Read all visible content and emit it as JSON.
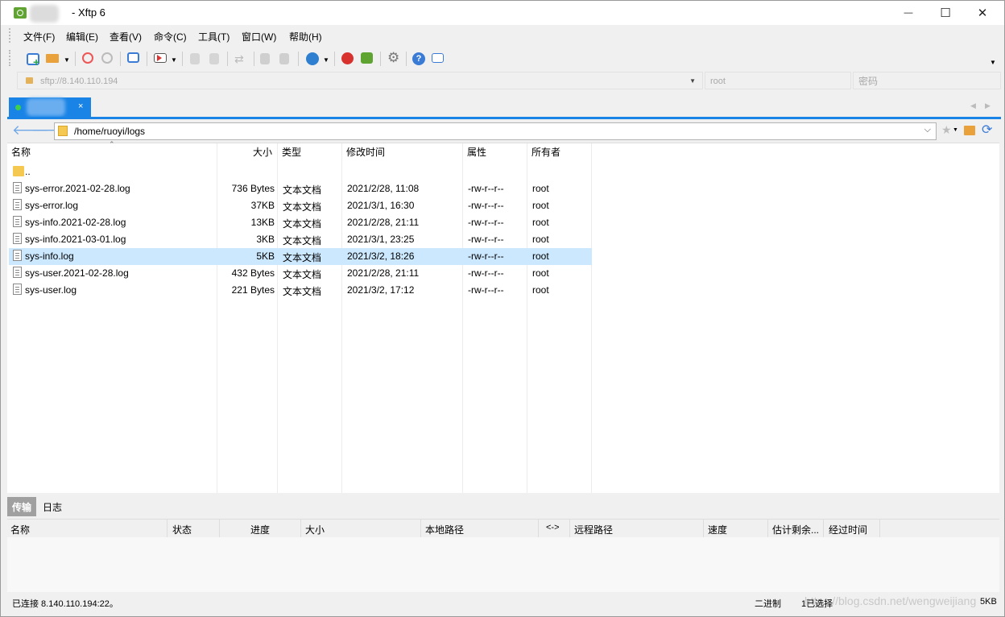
{
  "window": {
    "title": "- Xftp 6",
    "minimize_glyph": "—",
    "maximize_glyph": "☐",
    "close_glyph": "✕"
  },
  "menu": {
    "items": [
      "文件(F)",
      "编辑(E)",
      "查看(V)",
      "命令(C)",
      "工具(T)",
      "窗口(W)",
      "帮助(H)"
    ]
  },
  "address": {
    "host": "sftp://8.140.110.194",
    "username": "root",
    "password_placeholder": "密码"
  },
  "session_tab": {
    "close_glyph": "×"
  },
  "path": {
    "current": "/home/ruoyi/logs"
  },
  "file_list": {
    "columns": [
      "名称",
      "大小",
      "类型",
      "修改时间",
      "属性",
      "所有者"
    ],
    "parent_dir": "..",
    "rows": [
      {
        "name": "sys-error.2021-02-28.log",
        "size": "736 Bytes",
        "type": "文本文档",
        "modified": "2021/2/28, 11:08",
        "attr": "-rw-r--r--",
        "owner": "root"
      },
      {
        "name": "sys-error.log",
        "size": "37KB",
        "type": "文本文档",
        "modified": "2021/3/1, 16:30",
        "attr": "-rw-r--r--",
        "owner": "root"
      },
      {
        "name": "sys-info.2021-02-28.log",
        "size": "13KB",
        "type": "文本文档",
        "modified": "2021/2/28, 21:11",
        "attr": "-rw-r--r--",
        "owner": "root"
      },
      {
        "name": "sys-info.2021-03-01.log",
        "size": "3KB",
        "type": "文本文档",
        "modified": "2021/3/1, 23:25",
        "attr": "-rw-r--r--",
        "owner": "root"
      },
      {
        "name": "sys-info.log",
        "size": "5KB",
        "type": "文本文档",
        "modified": "2021/3/2, 18:26",
        "attr": "-rw-r--r--",
        "owner": "root",
        "selected": true
      },
      {
        "name": "sys-user.2021-02-28.log",
        "size": "432 Bytes",
        "type": "文本文档",
        "modified": "2021/2/28, 21:11",
        "attr": "-rw-r--r--",
        "owner": "root"
      },
      {
        "name": "sys-user.log",
        "size": "221 Bytes",
        "type": "文本文档",
        "modified": "2021/3/2, 17:12",
        "attr": "-rw-r--r--",
        "owner": "root"
      }
    ]
  },
  "bottom_tabs": [
    "传输",
    "日志"
  ],
  "transfer_columns": [
    "名称",
    "状态",
    "进度",
    "大小",
    "本地路径",
    "<->",
    "远程路径",
    "速度",
    "估计剩余...",
    "经过时间"
  ],
  "status": {
    "connection": "已连接 8.140.110.194:22。",
    "mode": "二进制",
    "selected": "1已选择",
    "size": "5KB",
    "watermark": "https://blog.csdn.net/wengweijiang"
  },
  "colors": {
    "accent": "#1a84e6",
    "selection": "#cce8ff",
    "folder": "#f5c851"
  }
}
